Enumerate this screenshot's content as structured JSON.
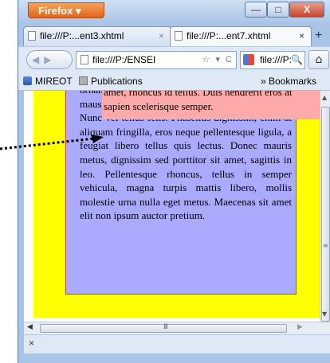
{
  "window": {
    "app_button_label": "Firefox ▾",
    "minimize_glyph": "—",
    "maximize_glyph": "□",
    "close_glyph": "X"
  },
  "tabs": [
    {
      "label": "file:///P:...ent3.xhtml",
      "close": "×",
      "active": false
    },
    {
      "label": "file:///P:...ent7.xhtml",
      "close": "×",
      "active": true
    }
  ],
  "new_tab_glyph": "+",
  "nav": {
    "back_forward_glyph": "◀▶",
    "url_value": "file:///P:/ENSEI",
    "url_tail_glyphs": "☆ ▾ C",
    "search_value": "file:///P:",
    "search_glyph": "🔍",
    "home_glyph": "⌂"
  },
  "bookmarks": {
    "items": [
      {
        "label": "MIREOT"
      },
      {
        "label": "Publications"
      }
    ],
    "overflow_label": "» Bookmarks"
  },
  "content": {
    "purple_box_text": "ornamet, rhoncus id tellus. Duis hendrerit eros at mausapien scelerisque semper. lobortis dictum. Nunc vel tellus felis. Phasellus dignissim, enim at aliquam fringilla, eros neque pellentesque ligula, a feugiat libero tellus quis lectus. Donec mauris metus, dignissim sed porttitor sit amet, sagittis in leo. Pellentesque rhoncus, tellus in semper vehicula, magna turpis mattis libero, mollis molestie urna nulla eget metus. Maecenas sit amet elit non ipsum auctor pretium.",
    "pink_box_text": "amet, rhoncus id tellus. Duis hendrerit eros at sapien scelerisque semper."
  },
  "scrollbars": {
    "up_glyph": "▲",
    "down_glyph": "▼",
    "left_glyph": "◀",
    "right_glyph": "▶",
    "v_grip": "≡",
    "h_grip": "III"
  },
  "status": {
    "close_glyph": "×"
  },
  "colors": {
    "yellow_area": "#ffff00",
    "purple_box": "#aaaaff",
    "pink_box": "#ffaaaa",
    "firefox_button": "#e0641a"
  }
}
